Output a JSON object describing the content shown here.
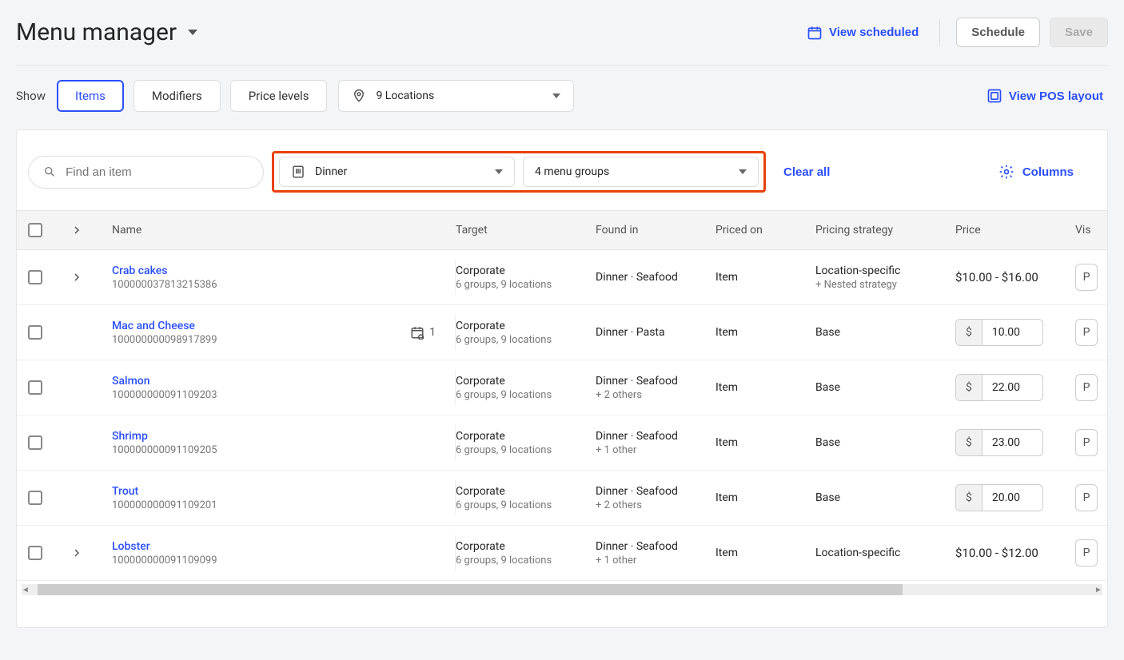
{
  "header": {
    "title": "Menu manager",
    "view_scheduled": "View scheduled",
    "schedule_btn": "Schedule",
    "save_btn": "Save"
  },
  "toolbar": {
    "show_label": "Show",
    "tabs": {
      "items": "Items",
      "modifiers": "Modifiers",
      "price_levels": "Price levels"
    },
    "locations": "9 Locations",
    "view_pos": "View POS layout"
  },
  "filters": {
    "search_placeholder": "Find an item",
    "menu": "Dinner",
    "groups": "4 menu groups",
    "clear": "Clear all",
    "columns": "Columns"
  },
  "columns": {
    "name": "Name",
    "target": "Target",
    "found_in": "Found in",
    "priced_on": "Priced on",
    "pricing_strategy": "Pricing strategy",
    "price": "Price",
    "vis": "Vis"
  },
  "rows": [
    {
      "name": "Crab cakes",
      "id": "100000037813215386",
      "expand": true,
      "sched": false,
      "target": "Corporate",
      "target_sub": "6 groups, 9 locations",
      "found": "Dinner · Seafood",
      "found_sub": "",
      "priced": "Item",
      "strategy": "Location-specific",
      "strategy_sub": "+ Nested strategy",
      "price_range": "$10.00 - $16.00",
      "price_input": null,
      "pill": "P"
    },
    {
      "name": "Mac and Cheese",
      "id": "100000000098917899",
      "expand": false,
      "sched": true,
      "sched_count": "1",
      "target": "Corporate",
      "target_sub": "6 groups, 9 locations",
      "found": "Dinner · Pasta",
      "found_sub": "",
      "priced": "Item",
      "strategy": "Base",
      "strategy_sub": "",
      "price_range": null,
      "price_input": "10.00",
      "pill": "P"
    },
    {
      "name": "Salmon",
      "id": "100000000091109203",
      "expand": false,
      "sched": false,
      "target": "Corporate",
      "target_sub": "6 groups, 9 locations",
      "found": "Dinner · Seafood",
      "found_sub": "+ 2 others",
      "priced": "Item",
      "strategy": "Base",
      "strategy_sub": "",
      "price_range": null,
      "price_input": "22.00",
      "pill": "P"
    },
    {
      "name": "Shrimp",
      "id": "100000000091109205",
      "expand": false,
      "sched": false,
      "target": "Corporate",
      "target_sub": "6 groups, 9 locations",
      "found": "Dinner · Seafood",
      "found_sub": "+ 1 other",
      "priced": "Item",
      "strategy": "Base",
      "strategy_sub": "",
      "price_range": null,
      "price_input": "23.00",
      "pill": "P"
    },
    {
      "name": "Trout",
      "id": "100000000091109201",
      "expand": false,
      "sched": false,
      "target": "Corporate",
      "target_sub": "6 groups, 9 locations",
      "found": "Dinner · Seafood",
      "found_sub": "+ 2 others",
      "priced": "Item",
      "strategy": "Base",
      "strategy_sub": "",
      "price_range": null,
      "price_input": "20.00",
      "pill": "P"
    },
    {
      "name": "Lobster",
      "id": "100000000091109099",
      "expand": true,
      "sched": false,
      "target": "Corporate",
      "target_sub": "6 groups, 9 locations",
      "found": "Dinner · Seafood",
      "found_sub": "+ 1 other",
      "priced": "Item",
      "strategy": "Location-specific",
      "strategy_sub": "",
      "price_range": "$10.00 - $12.00",
      "price_input": null,
      "pill": "P"
    }
  ]
}
